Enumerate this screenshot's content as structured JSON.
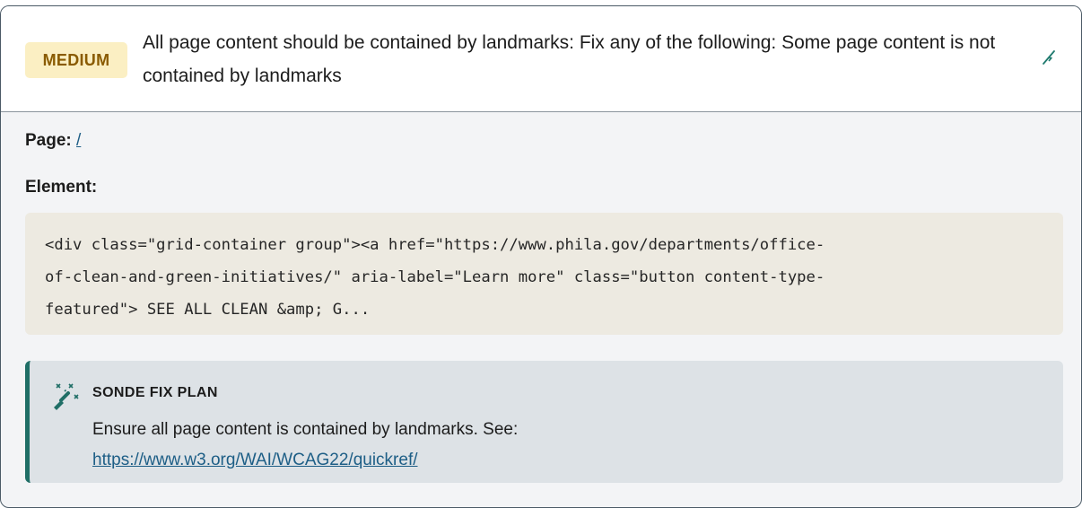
{
  "issue": {
    "severity": "MEDIUM",
    "title": "All page content should be contained by landmarks: Fix any of the following: Some page content is not contained by landmarks",
    "edit_icon": "wand-edit-icon"
  },
  "details": {
    "page_label": "Page:",
    "page_value": "/",
    "element_label": "Element:",
    "element_code": "<div class=\"grid-container group\"><a href=\"https://www.phila.gov/departments/office-\nof-clean-and-green-initiatives/\" aria-label=\"Learn more\" class=\"button content-type-\nfeatured\"> SEE ALL CLEAN &amp; G..."
  },
  "fix_plan": {
    "icon": "magic-wand-sparkles-icon",
    "heading": "SONDE FIX PLAN",
    "text": "Ensure all page content is contained by landmarks. See:",
    "link": "https://www.w3.org/WAI/WCAG22/quickref/"
  },
  "colors": {
    "badge_bg": "#fbefc3",
    "badge_text": "#8a5b00",
    "link": "#1d5e86",
    "accent": "#1f6e66",
    "code_bg": "#edeae1"
  }
}
